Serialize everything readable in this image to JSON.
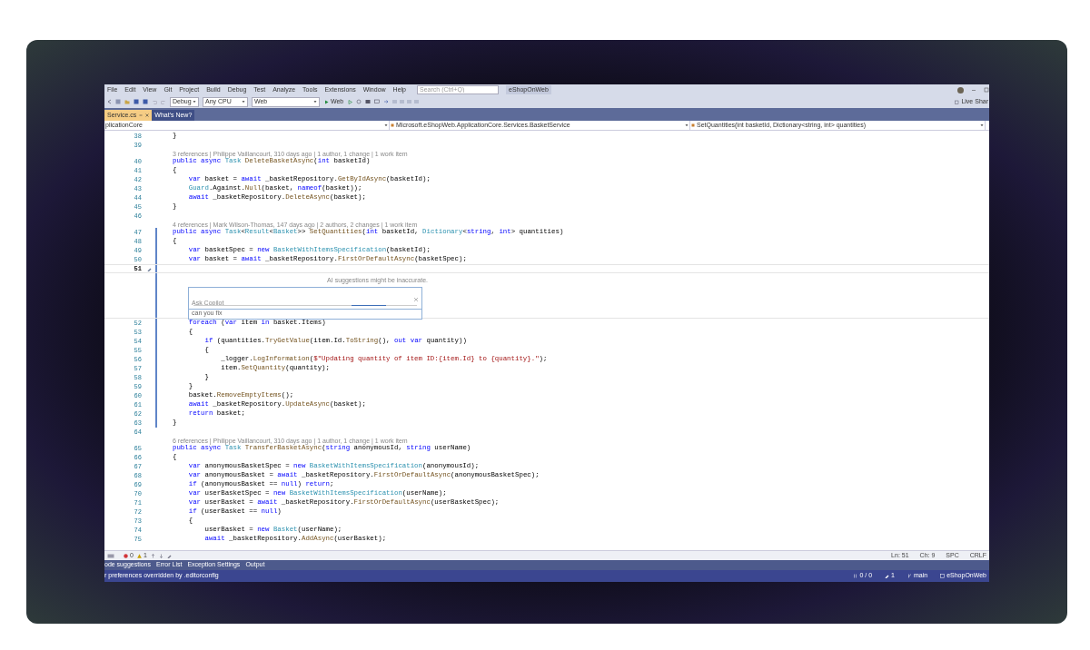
{
  "window": {
    "menu": [
      "File",
      "Edit",
      "View",
      "Git",
      "Project",
      "Build",
      "Debug",
      "Test",
      "Analyze",
      "Tools",
      "Extensions",
      "Window",
      "Help"
    ],
    "search": {
      "placeholder": "Search (Ctrl+Q)"
    },
    "solution": "eShopOnWeb",
    "live_share": "Live Shar"
  },
  "toolbar": {
    "configuration": "Debug",
    "platform": "Any CPU",
    "project": "Web",
    "run": "Web"
  },
  "tabs": [
    {
      "label": "Service.cs",
      "selected": true
    },
    {
      "label": "What's New?",
      "selected": false
    }
  ],
  "navigation": {
    "project": "plicationCore",
    "type": "Microsoft.eShopWeb.ApplicationCore.Services.BasketService",
    "member": "SetQuantities(int basketId, Dictionary<string, int> quantities)"
  },
  "code": {
    "lines": [
      {
        "kind": "code",
        "number": "38",
        "tokens": [
          {
            "kind": "p",
            "text": "}"
          }
        ]
      },
      {
        "kind": "code",
        "number": "39"
      },
      {
        "kind": "lens",
        "text": "3 references | Philippe Vaillancourt, 310 days ago | 1 author, 1 change | 1 work item"
      },
      {
        "kind": "code",
        "number": "40",
        "tokens": [
          {
            "kind": "k",
            "text": "public async "
          },
          {
            "kind": "t",
            "text": "Task"
          },
          {
            "kind": "m",
            "text": " DeleteBasketAsync"
          },
          {
            "kind": "p",
            "text": "("
          },
          {
            "kind": "k",
            "text": "int"
          },
          {
            "kind": "p",
            "text": " basketId)"
          }
        ]
      },
      {
        "kind": "code",
        "number": "41",
        "tokens": [
          {
            "kind": "p",
            "text": "{"
          }
        ]
      },
      {
        "kind": "code",
        "number": "42",
        "tokens": [
          {
            "kind": "k",
            "text": "    var"
          },
          {
            "kind": "p",
            "text": " basket = "
          },
          {
            "kind": "k",
            "text": "await"
          },
          {
            "kind": "p",
            "text": " _basketRepository."
          },
          {
            "kind": "m",
            "text": "GetByIdAsync"
          },
          {
            "kind": "p",
            "text": "(basketId);"
          }
        ]
      },
      {
        "kind": "code",
        "number": "43",
        "tokens": [
          {
            "kind": "t",
            "text": "    Guard"
          },
          {
            "kind": "p",
            "text": ".Against."
          },
          {
            "kind": "m",
            "text": "Null"
          },
          {
            "kind": "p",
            "text": "(basket, "
          },
          {
            "kind": "k",
            "text": "nameof"
          },
          {
            "kind": "p",
            "text": "(basket));"
          }
        ]
      },
      {
        "kind": "code",
        "number": "44",
        "tokens": [
          {
            "kind": "k",
            "text": "    await"
          },
          {
            "kind": "p",
            "text": " _basketRepository."
          },
          {
            "kind": "m",
            "text": "DeleteAsync"
          },
          {
            "kind": "p",
            "text": "(basket);"
          }
        ]
      },
      {
        "kind": "code",
        "number": "45",
        "tokens": [
          {
            "kind": "p",
            "text": "}"
          }
        ]
      },
      {
        "kind": "code",
        "number": "46"
      },
      {
        "kind": "lens",
        "text": "4 references | Mark Wilson-Thomas, 147 days ago | 2 authors, 2 changes | 1 work item"
      },
      {
        "kind": "code",
        "number": "47",
        "changed": true,
        "tokens": [
          {
            "kind": "k",
            "text": "public async "
          },
          {
            "kind": "t",
            "text": "Task"
          },
          {
            "kind": "p",
            "text": "<"
          },
          {
            "kind": "t",
            "text": "Result"
          },
          {
            "kind": "p",
            "text": "<"
          },
          {
            "kind": "t",
            "text": "Basket"
          },
          {
            "kind": "p",
            "text": ">> "
          },
          {
            "kind": "m",
            "text": "SetQuantities"
          },
          {
            "kind": "p",
            "text": "("
          },
          {
            "kind": "k",
            "text": "int"
          },
          {
            "kind": "p",
            "text": " basketId, "
          },
          {
            "kind": "t",
            "text": "Dictionary"
          },
          {
            "kind": "p",
            "text": "<"
          },
          {
            "kind": "k",
            "text": "string"
          },
          {
            "kind": "p",
            "text": ", "
          },
          {
            "kind": "k",
            "text": "int"
          },
          {
            "kind": "p",
            "text": "> quantities)"
          }
        ]
      },
      {
        "kind": "code",
        "number": "48",
        "changed": true,
        "tokens": [
          {
            "kind": "p",
            "text": "{"
          }
        ]
      },
      {
        "kind": "code",
        "number": "49",
        "changed": true,
        "tokens": [
          {
            "kind": "k",
            "text": "    var"
          },
          {
            "kind": "p",
            "text": " basketSpec = "
          },
          {
            "kind": "k",
            "text": "new"
          },
          {
            "kind": "t",
            "text": " BasketWithItemsSpecification"
          },
          {
            "kind": "p",
            "text": "(basketId);"
          }
        ]
      },
      {
        "kind": "code",
        "number": "50",
        "changed": true,
        "tokens": [
          {
            "kind": "k",
            "text": "    var"
          },
          {
            "kind": "p",
            "text": " basket = "
          },
          {
            "kind": "k",
            "text": "await"
          },
          {
            "kind": "p",
            "text": " _basketRepository."
          },
          {
            "kind": "m",
            "text": "FirstOrDefaultAsync"
          },
          {
            "kind": "p",
            "text": "(basketSpec);"
          }
        ]
      },
      {
        "kind": "code",
        "number": "51",
        "changed": true,
        "current": true
      },
      {
        "kind": "chat",
        "notice": "AI suggestions might be inaccurate.",
        "placeholder": "Ask Copilot",
        "history": "can you fix"
      },
      {
        "kind": "code",
        "number": "52",
        "changed": true,
        "tokens": [
          {
            "kind": "k",
            "text": "    foreach"
          },
          {
            "kind": "p",
            "text": " ("
          },
          {
            "kind": "k",
            "text": "var"
          },
          {
            "kind": "p",
            "text": " item "
          },
          {
            "kind": "k",
            "text": "in"
          },
          {
            "kind": "p",
            "text": " basket.Items)"
          }
        ]
      },
      {
        "kind": "code",
        "number": "53",
        "changed": true,
        "tokens": [
          {
            "kind": "p",
            "text": "    {"
          }
        ]
      },
      {
        "kind": "code",
        "number": "54",
        "changed": true,
        "tokens": [
          {
            "kind": "k",
            "text": "        if"
          },
          {
            "kind": "p",
            "text": " (quantities."
          },
          {
            "kind": "m",
            "text": "TryGetValue"
          },
          {
            "kind": "p",
            "text": "(item.Id."
          },
          {
            "kind": "m",
            "text": "ToString"
          },
          {
            "kind": "p",
            "text": "(), "
          },
          {
            "kind": "k",
            "text": "out var"
          },
          {
            "kind": "p",
            "text": " quantity))"
          }
        ]
      },
      {
        "kind": "code",
        "number": "55",
        "changed": true,
        "tokens": [
          {
            "kind": "p",
            "text": "        {"
          }
        ]
      },
      {
        "kind": "code",
        "number": "56",
        "changed": true,
        "tokens": [
          {
            "kind": "p",
            "text": "            _logger."
          },
          {
            "kind": "m",
            "text": "LogInformation"
          },
          {
            "kind": "p",
            "text": "("
          },
          {
            "kind": "s",
            "text": "$\"Updating quantity of item ID:{item.Id} to {quantity}.\""
          },
          {
            "kind": "p",
            "text": ");"
          }
        ]
      },
      {
        "kind": "code",
        "number": "57",
        "changed": true,
        "tokens": [
          {
            "kind": "p",
            "text": "            item."
          },
          {
            "kind": "m",
            "text": "SetQuantity"
          },
          {
            "kind": "p",
            "text": "(quantity);"
          }
        ]
      },
      {
        "kind": "code",
        "number": "58",
        "changed": true,
        "tokens": [
          {
            "kind": "p",
            "text": "        }"
          }
        ]
      },
      {
        "kind": "code",
        "number": "59",
        "changed": true,
        "tokens": [
          {
            "kind": "p",
            "text": "    }"
          }
        ]
      },
      {
        "kind": "code",
        "number": "60",
        "changed": true,
        "tokens": [
          {
            "kind": "p",
            "text": "    basket."
          },
          {
            "kind": "m",
            "text": "RemoveEmptyItems"
          },
          {
            "kind": "p",
            "text": "();"
          }
        ]
      },
      {
        "kind": "code",
        "number": "61",
        "changed": true,
        "tokens": [
          {
            "kind": "k",
            "text": "    await"
          },
          {
            "kind": "p",
            "text": " _basketRepository."
          },
          {
            "kind": "m",
            "text": "UpdateAsync"
          },
          {
            "kind": "p",
            "text": "(basket);"
          }
        ]
      },
      {
        "kind": "code",
        "number": "62",
        "changed": true,
        "tokens": [
          {
            "kind": "k",
            "text": "    return"
          },
          {
            "kind": "p",
            "text": " basket;"
          }
        ]
      },
      {
        "kind": "code",
        "number": "63",
        "changed": true,
        "tokens": [
          {
            "kind": "p",
            "text": "}"
          }
        ]
      },
      {
        "kind": "code",
        "number": "64"
      },
      {
        "kind": "lens",
        "text": "6 references | Philippe Vaillancourt, 310 days ago | 1 author, 1 change | 1 work item"
      },
      {
        "kind": "code",
        "number": "65",
        "tokens": [
          {
            "kind": "k",
            "text": "public async "
          },
          {
            "kind": "t",
            "text": "Task"
          },
          {
            "kind": "m",
            "text": " TransferBasketAsync"
          },
          {
            "kind": "p",
            "text": "("
          },
          {
            "kind": "k",
            "text": "string"
          },
          {
            "kind": "p",
            "text": " anonymousId, "
          },
          {
            "kind": "k",
            "text": "string"
          },
          {
            "kind": "p",
            "text": " userName)"
          }
        ]
      },
      {
        "kind": "code",
        "number": "66",
        "tokens": [
          {
            "kind": "p",
            "text": "{"
          }
        ]
      },
      {
        "kind": "code",
        "number": "67",
        "tokens": [
          {
            "kind": "k",
            "text": "    var"
          },
          {
            "kind": "p",
            "text": " anonymousBasketSpec = "
          },
          {
            "kind": "k",
            "text": "new"
          },
          {
            "kind": "t",
            "text": " BasketWithItemsSpecification"
          },
          {
            "kind": "p",
            "text": "(anonymousId);"
          }
        ]
      },
      {
        "kind": "code",
        "number": "68",
        "tokens": [
          {
            "kind": "k",
            "text": "    var"
          },
          {
            "kind": "p",
            "text": " anonymousBasket = "
          },
          {
            "kind": "k",
            "text": "await"
          },
          {
            "kind": "p",
            "text": " _basketRepository."
          },
          {
            "kind": "m",
            "text": "FirstOrDefaultAsync"
          },
          {
            "kind": "p",
            "text": "(anonymousBasketSpec);"
          }
        ]
      },
      {
        "kind": "code",
        "number": "69",
        "tokens": [
          {
            "kind": "k",
            "text": "    if"
          },
          {
            "kind": "p",
            "text": " (anonymousBasket == "
          },
          {
            "kind": "k",
            "text": "null"
          },
          {
            "kind": "p",
            "text": ") "
          },
          {
            "kind": "k",
            "text": "return"
          },
          {
            "kind": "p",
            "text": ";"
          }
        ]
      },
      {
        "kind": "code",
        "number": "70",
        "tokens": [
          {
            "kind": "k",
            "text": "    var"
          },
          {
            "kind": "p",
            "text": " userBasketSpec = "
          },
          {
            "kind": "k",
            "text": "new"
          },
          {
            "kind": "t",
            "text": " BasketWithItemsSpecification"
          },
          {
            "kind": "p",
            "text": "(userName);"
          }
        ]
      },
      {
        "kind": "code",
        "number": "71",
        "tokens": [
          {
            "kind": "k",
            "text": "    var"
          },
          {
            "kind": "p",
            "text": " userBasket = "
          },
          {
            "kind": "k",
            "text": "await"
          },
          {
            "kind": "p",
            "text": " _basketRepository."
          },
          {
            "kind": "m",
            "text": "FirstOrDefaultAsync"
          },
          {
            "kind": "p",
            "text": "(userBasketSpec);"
          }
        ]
      },
      {
        "kind": "code",
        "number": "72",
        "tokens": [
          {
            "kind": "k",
            "text": "    if"
          },
          {
            "kind": "p",
            "text": " (userBasket == "
          },
          {
            "kind": "k",
            "text": "null"
          },
          {
            "kind": "p",
            "text": ")"
          }
        ]
      },
      {
        "kind": "code",
        "number": "73",
        "tokens": [
          {
            "kind": "p",
            "text": "    {"
          }
        ]
      },
      {
        "kind": "code",
        "number": "74",
        "tokens": [
          {
            "kind": "p",
            "text": "        userBasket = "
          },
          {
            "kind": "k",
            "text": "new"
          },
          {
            "kind": "t",
            "text": " Basket"
          },
          {
            "kind": "p",
            "text": "(userName);"
          }
        ]
      },
      {
        "kind": "code",
        "number": "75",
        "tokens": [
          {
            "kind": "k",
            "text": "        await"
          },
          {
            "kind": "p",
            "text": " _basketRepository."
          },
          {
            "kind": "m",
            "text": "AddAsync"
          },
          {
            "kind": "p",
            "text": "(userBasket);"
          }
        ]
      }
    ]
  },
  "editor_status": {
    "errors": "0",
    "warnings": "1",
    "position": [
      "Ln: 51",
      "Ch: 9",
      "SPC",
      "CRLF"
    ]
  },
  "tool_tabs": [
    "ode suggestions",
    "Error List",
    "Exception Settings",
    "Output"
  ],
  "status_bar": {
    "message": "r preferences overridden by .editorconfig",
    "changes": "0 / 0",
    "edits": "1",
    "branch": "main",
    "repository": "eShopOnWeb"
  }
}
